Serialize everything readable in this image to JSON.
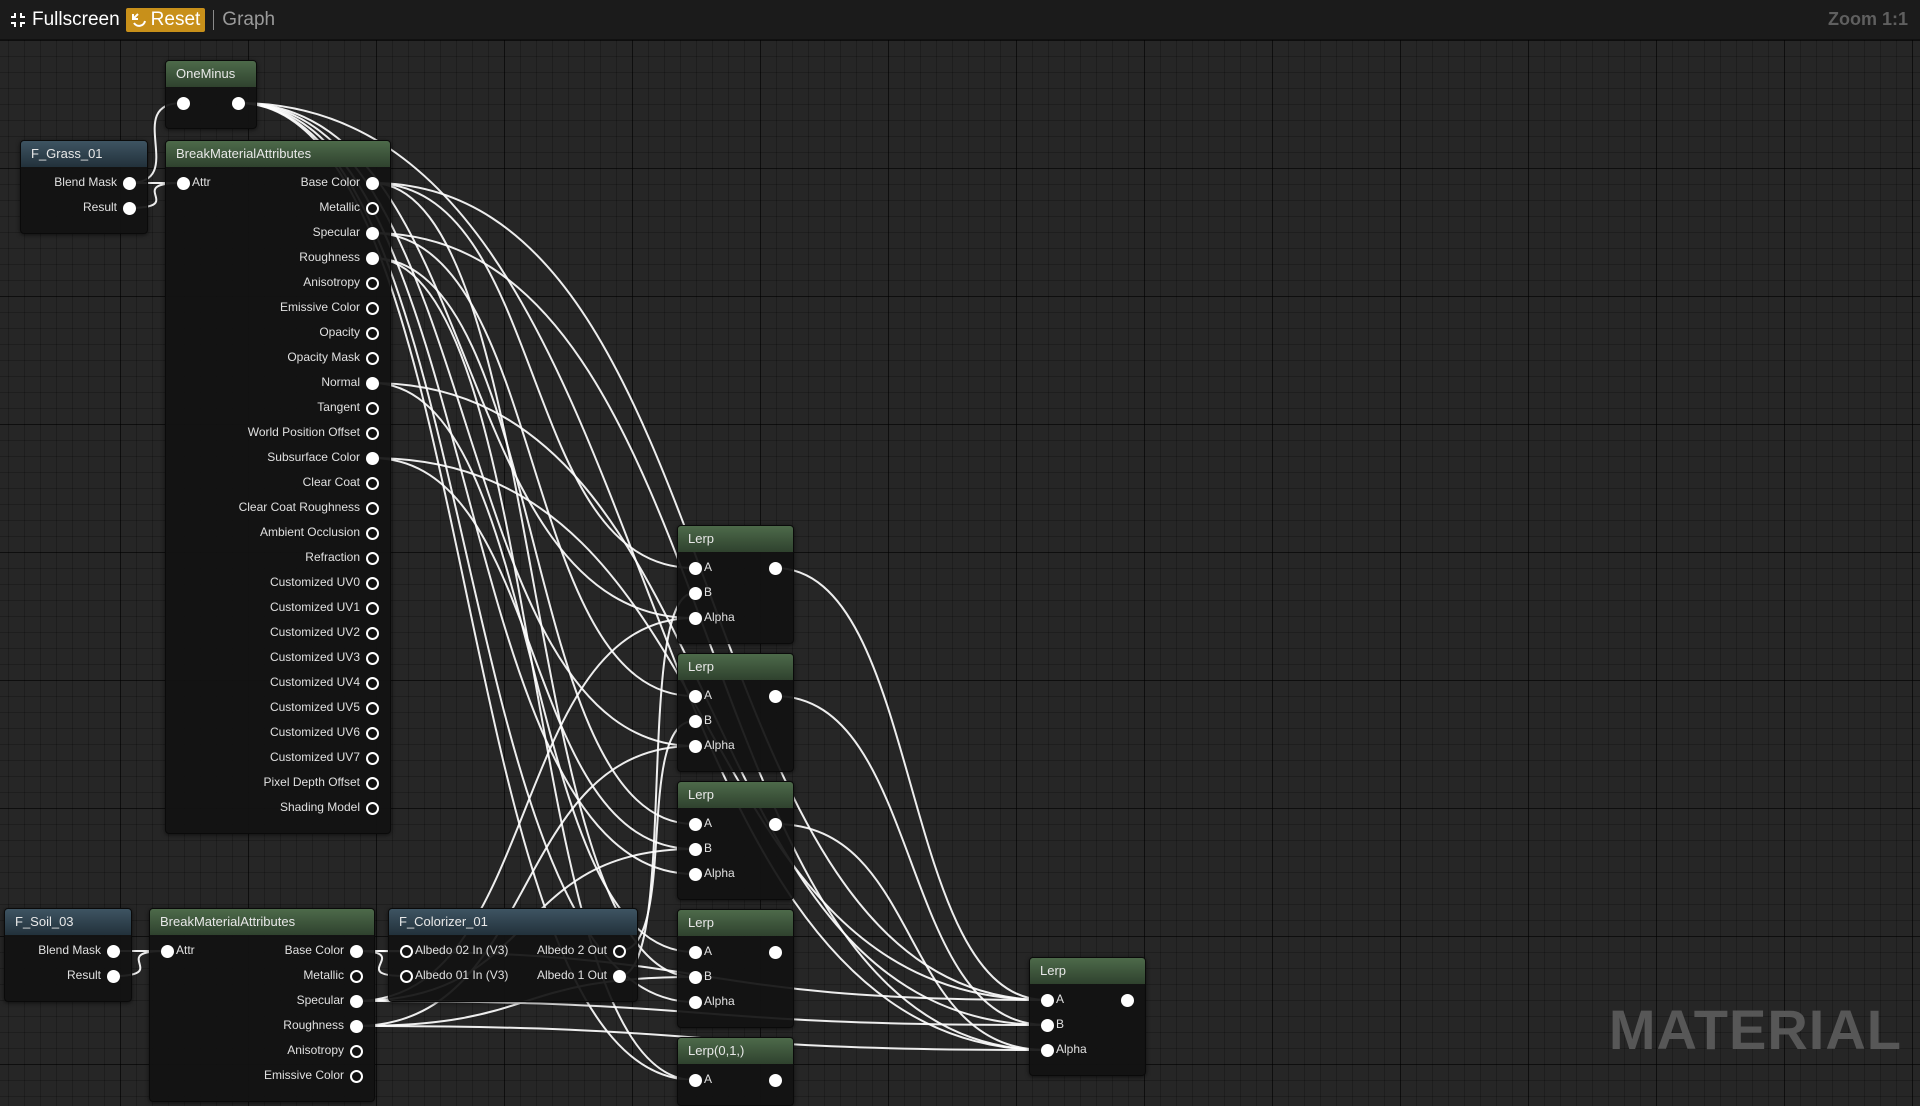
{
  "toolbar": {
    "fullscreen_label": "Fullscreen",
    "reset_label": "Reset",
    "graph_label": "Graph",
    "zoom_label": "Zoom 1:1"
  },
  "watermark": "MATERIAL",
  "colors": {
    "background": "#262626",
    "toolbar": "#1b1b1b",
    "reset_accent": "#c8901a",
    "function_header": "#2e404c",
    "expression_header": "#3f5a3d",
    "wire": "#ffffff"
  },
  "icons": {
    "fullscreen": "fullscreen-icon",
    "reset": "reset-icon"
  },
  "nodes": [
    {
      "id": "oneminus",
      "title": "OneMinus",
      "header": "green",
      "inputs": [
        {
          "label": "",
          "filled": true
        }
      ],
      "outputs": [
        {
          "label": "",
          "filled": true
        }
      ]
    },
    {
      "id": "f_grass",
      "title": "F_Grass_01",
      "header": "blue",
      "inputs": [],
      "outputs": [
        {
          "label": "Blend Mask",
          "filled": true
        },
        {
          "label": "Result",
          "filled": true
        }
      ]
    },
    {
      "id": "bma1",
      "title": "BreakMaterialAttributes",
      "header": "green",
      "inputs": [
        {
          "label": "Attr",
          "filled": true
        }
      ],
      "outputs": [
        {
          "label": "Base Color",
          "filled": true
        },
        {
          "label": "Metallic",
          "filled": false
        },
        {
          "label": "Specular",
          "filled": true
        },
        {
          "label": "Roughness",
          "filled": true
        },
        {
          "label": "Anisotropy",
          "filled": false
        },
        {
          "label": "Emissive Color",
          "filled": false
        },
        {
          "label": "Opacity",
          "filled": false
        },
        {
          "label": "Opacity Mask",
          "filled": false
        },
        {
          "label": "Normal",
          "filled": true
        },
        {
          "label": "Tangent",
          "filled": false
        },
        {
          "label": "World Position Offset",
          "filled": false
        },
        {
          "label": "Subsurface Color",
          "filled": true
        },
        {
          "label": "Clear Coat",
          "filled": false
        },
        {
          "label": "Clear Coat Roughness",
          "filled": false
        },
        {
          "label": "Ambient Occlusion",
          "filled": false
        },
        {
          "label": "Refraction",
          "filled": false
        },
        {
          "label": "Customized UV0",
          "filled": false
        },
        {
          "label": "Customized UV1",
          "filled": false
        },
        {
          "label": "Customized UV2",
          "filled": false
        },
        {
          "label": "Customized UV3",
          "filled": false
        },
        {
          "label": "Customized UV4",
          "filled": false
        },
        {
          "label": "Customized UV5",
          "filled": false
        },
        {
          "label": "Customized UV6",
          "filled": false
        },
        {
          "label": "Customized UV7",
          "filled": false
        },
        {
          "label": "Pixel Depth Offset",
          "filled": false
        },
        {
          "label": "Shading Model",
          "filled": false
        }
      ]
    },
    {
      "id": "lerp1",
      "title": "Lerp",
      "header": "green",
      "inputs": [
        {
          "label": "A",
          "filled": true
        },
        {
          "label": "B",
          "filled": true
        },
        {
          "label": "Alpha",
          "filled": true
        }
      ],
      "outputs": [
        {
          "label": "",
          "filled": true
        }
      ]
    },
    {
      "id": "lerp2",
      "title": "Lerp",
      "header": "green",
      "inputs": [
        {
          "label": "A",
          "filled": true
        },
        {
          "label": "B",
          "filled": true
        },
        {
          "label": "Alpha",
          "filled": true
        }
      ],
      "outputs": [
        {
          "label": "",
          "filled": true
        }
      ]
    },
    {
      "id": "lerp3",
      "title": "Lerp",
      "header": "green",
      "inputs": [
        {
          "label": "A",
          "filled": true
        },
        {
          "label": "B",
          "filled": true
        },
        {
          "label": "Alpha",
          "filled": true
        }
      ],
      "outputs": [
        {
          "label": "",
          "filled": true
        }
      ]
    },
    {
      "id": "lerp4",
      "title": "Lerp",
      "header": "green",
      "inputs": [
        {
          "label": "A",
          "filled": true
        },
        {
          "label": "B",
          "filled": true
        },
        {
          "label": "Alpha",
          "filled": true
        }
      ],
      "outputs": [
        {
          "label": "",
          "filled": true
        }
      ]
    },
    {
      "id": "lerp5",
      "title": "Lerp(0,1,)",
      "header": "green",
      "inputs": [
        {
          "label": "A",
          "filled": true
        }
      ],
      "outputs": [
        {
          "label": "",
          "filled": true
        }
      ]
    },
    {
      "id": "f_soil",
      "title": "F_Soil_03",
      "header": "blue",
      "inputs": [],
      "outputs": [
        {
          "label": "Blend Mask",
          "filled": true
        },
        {
          "label": "Result",
          "filled": true
        }
      ]
    },
    {
      "id": "bma2",
      "title": "BreakMaterialAttributes",
      "header": "green",
      "inputs": [
        {
          "label": "Attr",
          "filled": true
        }
      ],
      "outputs": [
        {
          "label": "Base Color",
          "filled": true
        },
        {
          "label": "Metallic",
          "filled": false
        },
        {
          "label": "Specular",
          "filled": true
        },
        {
          "label": "Roughness",
          "filled": true
        },
        {
          "label": "Anisotropy",
          "filled": false
        },
        {
          "label": "Emissive Color",
          "filled": false
        }
      ]
    },
    {
      "id": "f_color",
      "title": "F_Colorizer_01",
      "header": "blue",
      "inputs": [
        {
          "label": "Albedo 02 In (V3)",
          "filled": false
        },
        {
          "label": "Albedo 01 In (V3)",
          "filled": false
        }
      ],
      "outputs": [
        {
          "label": "Albedo 2 Out",
          "filled": false
        },
        {
          "label": "Albedo 1 Out",
          "filled": true
        }
      ]
    },
    {
      "id": "lerp6",
      "title": "Lerp",
      "header": "green",
      "inputs": [
        {
          "label": "A",
          "filled": true
        },
        {
          "label": "B",
          "filled": true
        },
        {
          "label": "Alpha",
          "filled": true
        }
      ],
      "outputs": [
        {
          "label": "",
          "filled": true
        }
      ]
    }
  ],
  "wires": [
    [
      "f_grass",
      "o",
      0,
      "oneminus",
      "i",
      0
    ],
    [
      "f_grass",
      "o",
      0,
      "bma1",
      "i",
      0
    ],
    [
      "f_grass",
      "o",
      1,
      "bma1",
      "i",
      0
    ],
    [
      "oneminus",
      "o",
      0,
      "lerp1",
      "i",
      2
    ],
    [
      "oneminus",
      "o",
      0,
      "lerp2",
      "i",
      2
    ],
    [
      "oneminus",
      "o",
      0,
      "lerp3",
      "i",
      2
    ],
    [
      "oneminus",
      "o",
      0,
      "lerp4",
      "i",
      2
    ],
    [
      "oneminus",
      "o",
      0,
      "lerp5",
      "i",
      0
    ],
    [
      "oneminus",
      "o",
      0,
      "lerp6",
      "i",
      2
    ],
    [
      "bma1",
      "o",
      0,
      "lerp1",
      "i",
      0
    ],
    [
      "bma1",
      "o",
      2,
      "lerp2",
      "i",
      0
    ],
    [
      "bma1",
      "o",
      3,
      "lerp3",
      "i",
      0
    ],
    [
      "bma1",
      "o",
      8,
      "lerp4",
      "i",
      0
    ],
    [
      "bma1",
      "o",
      11,
      "lerp6",
      "i",
      0
    ],
    [
      "bma1",
      "o",
      0,
      "lerp4",
      "i",
      1
    ],
    [
      "bma1",
      "o",
      3,
      "lerp5",
      "i",
      0
    ],
    [
      "bma1",
      "o",
      8,
      "lerp6",
      "i",
      1
    ],
    [
      "bma1",
      "o",
      11,
      "lerp3",
      "i",
      1
    ],
    [
      "bma1",
      "o",
      2,
      "lerp6",
      "i",
      2
    ],
    [
      "bma1",
      "o",
      0,
      "lerp6",
      "i",
      0
    ],
    [
      "f_soil",
      "o",
      0,
      "bma2",
      "i",
      0
    ],
    [
      "f_soil",
      "o",
      1,
      "bma2",
      "i",
      0
    ],
    [
      "bma2",
      "o",
      0,
      "f_color",
      "i",
      1
    ],
    [
      "bma2",
      "o",
      0,
      "f_color",
      "i",
      0
    ],
    [
      "f_color",
      "o",
      1,
      "lerp1",
      "i",
      1
    ],
    [
      "f_color",
      "o",
      0,
      "lerp2",
      "i",
      1
    ],
    [
      "bma2",
      "o",
      2,
      "lerp3",
      "i",
      1
    ],
    [
      "bma2",
      "o",
      3,
      "lerp4",
      "i",
      1
    ],
    [
      "bma2",
      "o",
      2,
      "lerp1",
      "i",
      2
    ],
    [
      "bma2",
      "o",
      3,
      "lerp2",
      "i",
      2
    ],
    [
      "bma2",
      "o",
      0,
      "lerp6",
      "i",
      0
    ],
    [
      "bma2",
      "o",
      2,
      "lerp6",
      "i",
      1
    ],
    [
      "bma2",
      "o",
      3,
      "lerp6",
      "i",
      2
    ],
    [
      "lerp1",
      "o",
      0,
      "lerp6",
      "i",
      0
    ],
    [
      "lerp2",
      "o",
      0,
      "lerp6",
      "i",
      1
    ],
    [
      "lerp3",
      "o",
      0,
      "lerp6",
      "i",
      2
    ]
  ]
}
